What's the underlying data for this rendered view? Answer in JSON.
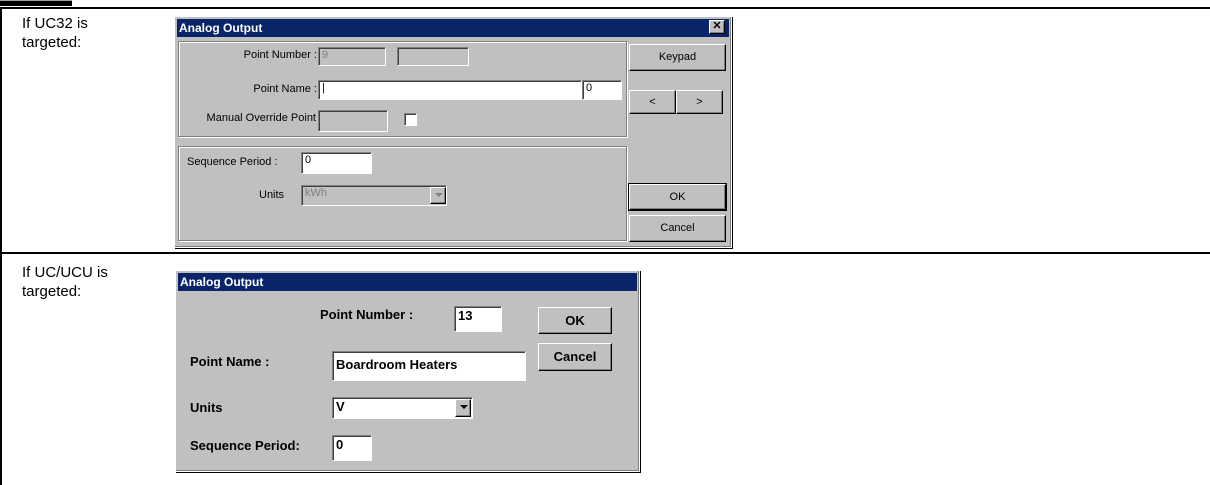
{
  "doc": {
    "fragment": "▬▬▬▬",
    "row1_label": "If UC32 is targeted:",
    "row2_label": "If UC/UCU is targeted:"
  },
  "dialog1": {
    "title": "Analog Output",
    "close_glyph": "✕",
    "point_number_label": "Point Number :",
    "point_number_value": "9",
    "point_number_extra": "",
    "point_name_label": "Point Name :",
    "point_name_value": "",
    "point_name_count": "0",
    "manual_override_label": "Manual Override Point",
    "manual_override_value": "",
    "manual_override_checked": false,
    "sequence_period_label": "Sequence Period :",
    "sequence_period_value": "0",
    "units_label": "Units",
    "units_value": "kWh",
    "keypad_label": "Keypad",
    "prev_label": "<",
    "next_label": ">",
    "ok_label": "OK",
    "cancel_label": "Cancel"
  },
  "dialog2": {
    "title": "Analog Output",
    "point_number_label": "Point Number :",
    "point_number_value": "13",
    "point_name_label": "Point Name :",
    "point_name_value": "Boardroom Heaters",
    "units_label": "Units",
    "units_value": "V",
    "sequence_period_label": "Sequence Period:",
    "sequence_period_value": "0",
    "ok_label": "OK",
    "cancel_label": "Cancel"
  },
  "colors": {
    "titlebar": "#0a246a",
    "dialog_face": "#c0c0c0"
  }
}
